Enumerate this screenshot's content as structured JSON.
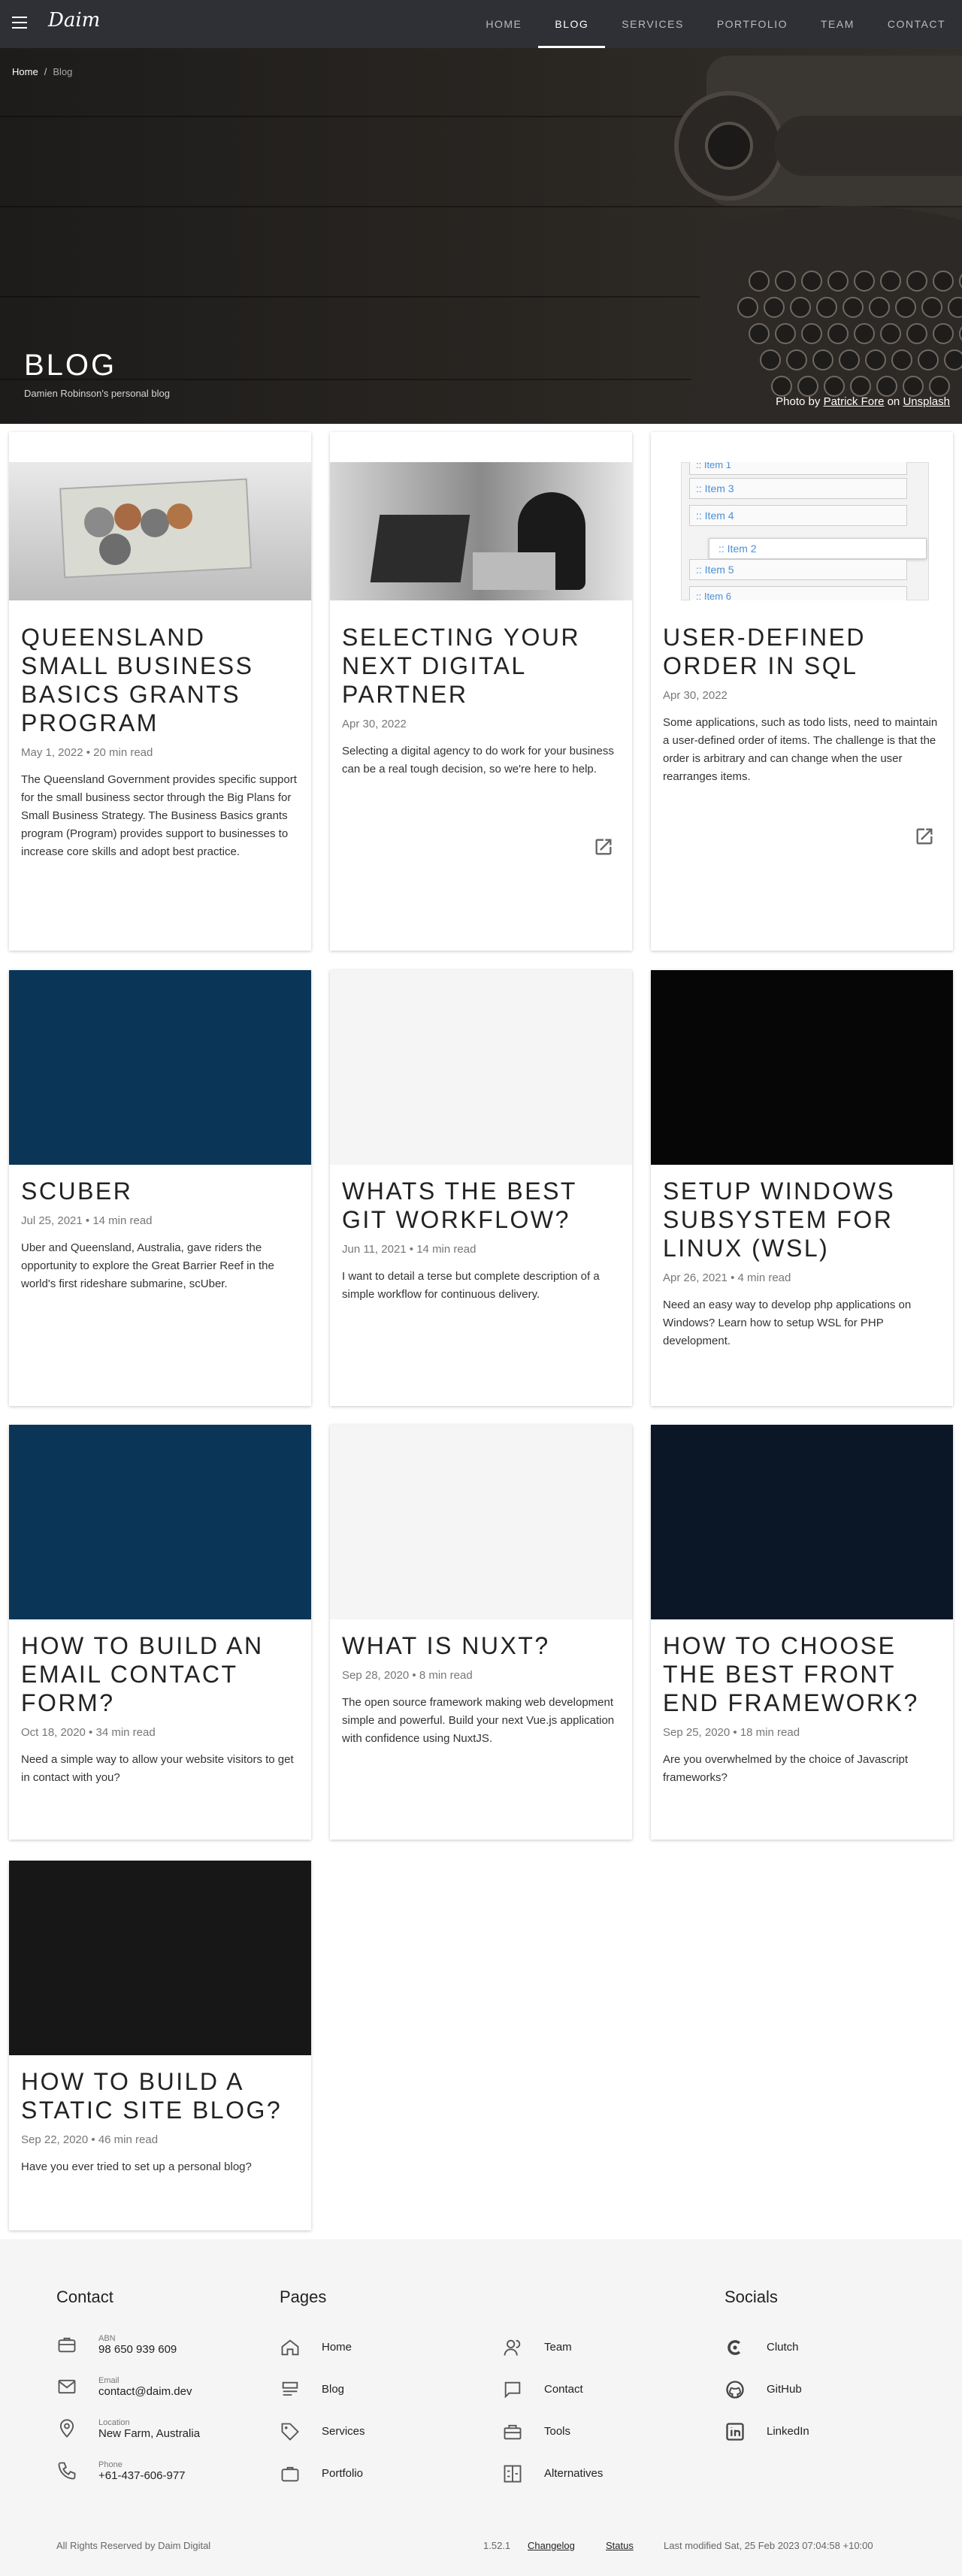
{
  "nav": {
    "logo": "Daim",
    "links": [
      "HOME",
      "BLOG",
      "SERVICES",
      "PORTFOLIO",
      "TEAM",
      "CONTACT"
    ]
  },
  "breadcrumb": {
    "home": "Home",
    "separator": "/",
    "current": "Blog"
  },
  "hero": {
    "title": "BLOG",
    "subtitle": "Damien Robinson's personal blog",
    "credit_prefix": "Photo by",
    "credit_author": "Patrick Fore",
    "credit_on": "on",
    "credit_site": "Unsplash"
  },
  "posts": [
    {
      "title": "QUEENSLAND SMALL BUSINESS BASICS GRANTS PROGRAM",
      "meta": "May 1, 2022 • 20 min read",
      "desc": "The Queensland Government provides specific support for the small business sector through the Big Plans for Small Business Strategy. The Business Basics grants program (Program) provides support to businesses to increase core skills and adopt best practice."
    },
    {
      "title": "SELECTING YOUR NEXT DIGITAL PARTNER",
      "meta": "Apr 30, 2022",
      "desc": "Selecting a digital agency to do work for your business can be a real tough decision, so we're here to help."
    },
    {
      "title": "USER-DEFINED ORDER IN SQL",
      "meta": "Apr 30, 2022",
      "desc": "Some applications, such as todo lists, need to maintain a user-defined order of items. The challenge is that the order is arbitrary and can change when the user rearranges items."
    },
    {
      "title": "SCUBER",
      "meta": "Jul 25, 2021 • 14 min read",
      "desc": "Uber and Queensland, Australia, gave riders the opportunity to explore the Great Barrier Reef in the world's first rideshare submarine, scUber."
    },
    {
      "title": "WHATS THE BEST GIT WORKFLOW?",
      "meta": "Jun 11, 2021 • 14 min read",
      "desc": "I want to detail a terse but complete description of a simple workflow for continuous delivery."
    },
    {
      "title": "SETUP WINDOWS SUBSYSTEM FOR LINUX (WSL)",
      "meta": "Apr 26, 2021 • 4 min read",
      "desc": "Need an easy way to develop php applications on Windows? Learn how to setup WSL for PHP development."
    },
    {
      "title": "HOW TO BUILD AN EMAIL CONTACT FORM?",
      "meta": "Oct 18, 2020 • 34 min read",
      "desc": "Need a simple way to allow your website visitors to get in contact with you?"
    },
    {
      "title": "WHAT IS NUXT?",
      "meta": "Sep 28, 2020 • 8 min read",
      "desc": "The open source framework making web development simple and powerful. Build your next Vue.js application with confidence using NuxtJS."
    },
    {
      "title": "HOW TO CHOOSE THE BEST FRONT END FRAMEWORK?",
      "meta": "Sep 25, 2020 • 18 min read",
      "desc": "Are you overwhelmed by the choice of Javascript frameworks?"
    },
    {
      "title": "HOW TO BUILD A STATIC SITE BLOG?",
      "meta": "Sep 22, 2020 • 46 min read",
      "desc": "Have you ever tried to set up a personal blog?"
    }
  ],
  "sql_list": [
    "Item 1",
    "Item 3",
    "Item 4",
    "Item 2",
    "Item 5",
    "Item 6"
  ],
  "footer": {
    "contact_heading": "Contact",
    "pages_heading": "Pages",
    "socials_heading": "Socials",
    "contact": [
      {
        "label": "ABN",
        "value": "98 650 939 609",
        "icon": "briefcase-icon"
      },
      {
        "label": "Email",
        "value": "contact@daim.dev",
        "icon": "mail-icon"
      },
      {
        "label": "Location",
        "value": "New Farm, Australia",
        "icon": "pin-icon"
      },
      {
        "label": "Phone",
        "value": "+61-437-606-977",
        "icon": "phone-icon"
      }
    ],
    "pages_col1": [
      "Home",
      "Blog",
      "Services",
      "Portfolio"
    ],
    "pages_col2": [
      "Team",
      "Contact",
      "Tools",
      "Alternatives"
    ],
    "socials": [
      "Clutch",
      "GitHub",
      "LinkedIn"
    ],
    "rights": "All Rights Reserved by Daim Digital",
    "version": "1.52.1",
    "changelog": "Changelog",
    "status": "Status",
    "modified": "Last modified Sat, 25 Feb 2023 07:04:58 +10:00"
  },
  "colors": {
    "nav": "#2e3035",
    "accent_blue": "#0b3556",
    "footer_bg": "#f5f5f5"
  }
}
